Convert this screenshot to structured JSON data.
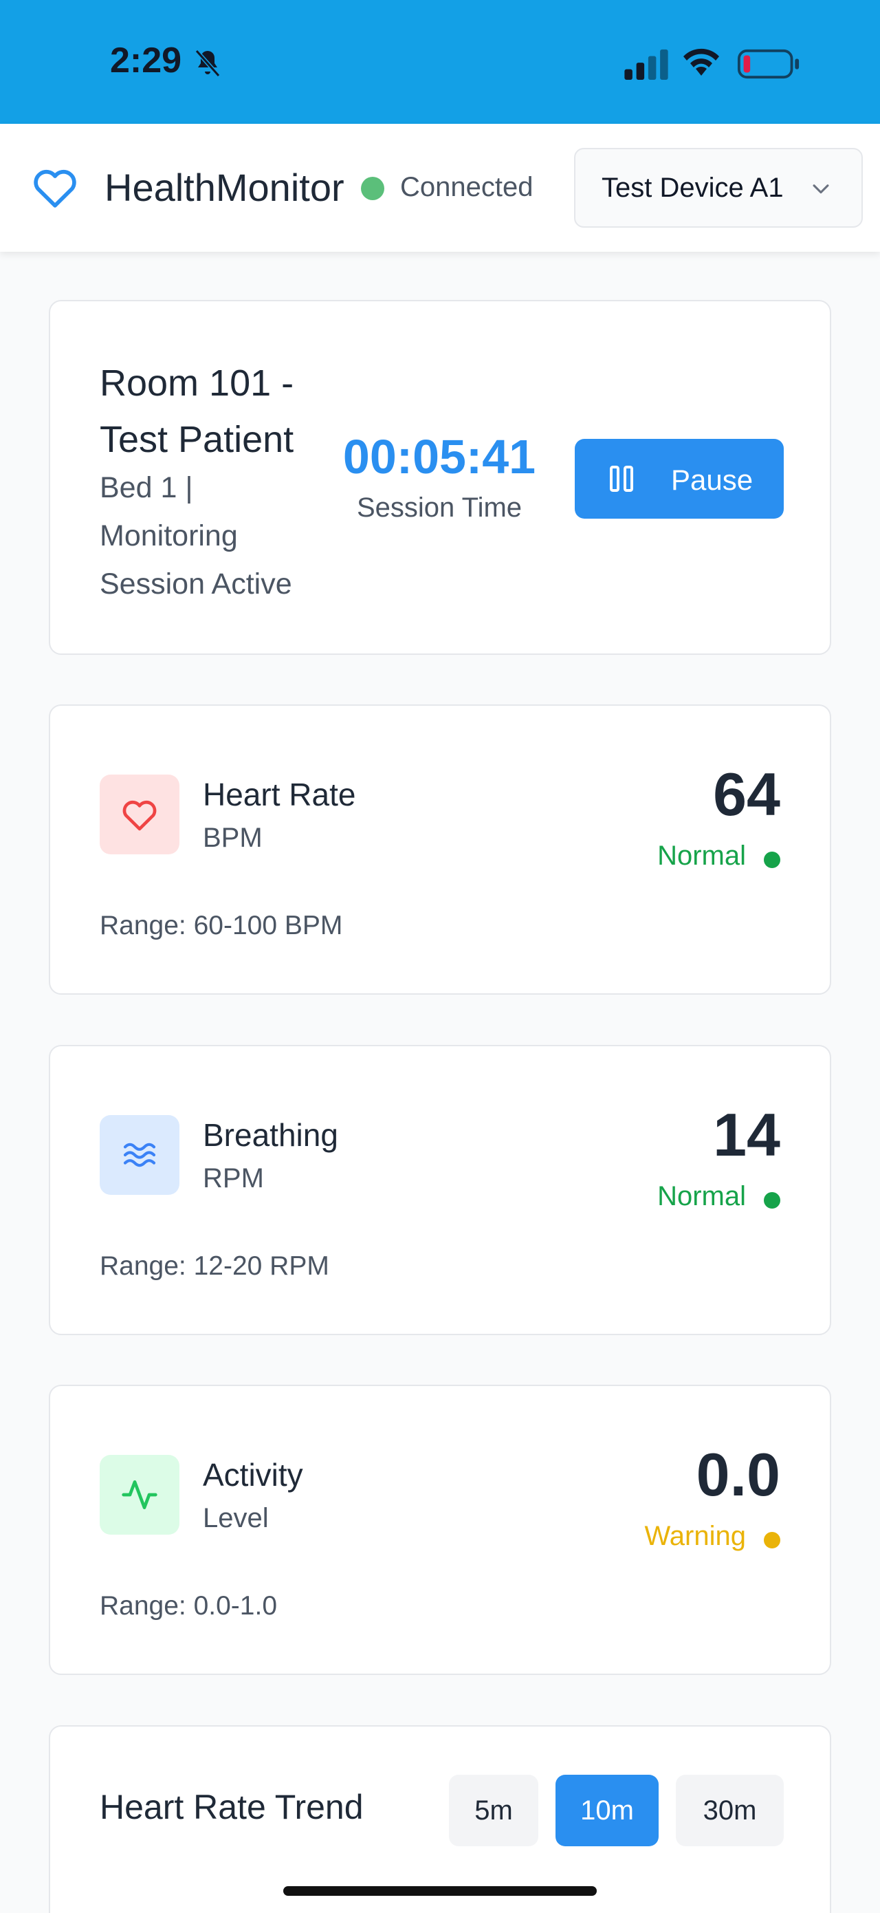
{
  "status_bar": {
    "time": "2:29",
    "icons": [
      "bell-slash-icon",
      "signal-icon",
      "wifi-icon",
      "battery-low-icon"
    ],
    "background_color": "#13a0e6"
  },
  "header": {
    "brand": "HealthMonitor",
    "logo_icon": "heart-outline-icon",
    "connection_status": "Connected",
    "connection_color": "#5bbf7a",
    "device_selected": "Test Device A1"
  },
  "session": {
    "room_title": "Room 101 - Test Patient",
    "subtitle": "Bed 1 | Monitoring Session Active",
    "time": "00:05:41",
    "time_label": "Session Time",
    "pause_label": "Pause",
    "accent_color": "#2a8ff0"
  },
  "metrics": [
    {
      "name": "Heart Rate",
      "unit": "BPM",
      "value": "64",
      "status": "Normal",
      "status_color": "#16a34a",
      "range": "Range: 60-100 BPM",
      "icon": "heart-icon"
    },
    {
      "name": "Breathing",
      "unit": "RPM",
      "value": "14",
      "status": "Normal",
      "status_color": "#16a34a",
      "range": "Range: 12-20 RPM",
      "icon": "waves-icon"
    },
    {
      "name": "Activity",
      "unit": "Level",
      "value": "0.0",
      "status": "Warning",
      "status_color": "#eab308",
      "range": "Range: 0.0-1.0",
      "icon": "activity-icon"
    }
  ],
  "trend": {
    "title": "Heart Rate Trend",
    "ranges": [
      "5m",
      "10m",
      "30m"
    ],
    "selected": "10m"
  }
}
